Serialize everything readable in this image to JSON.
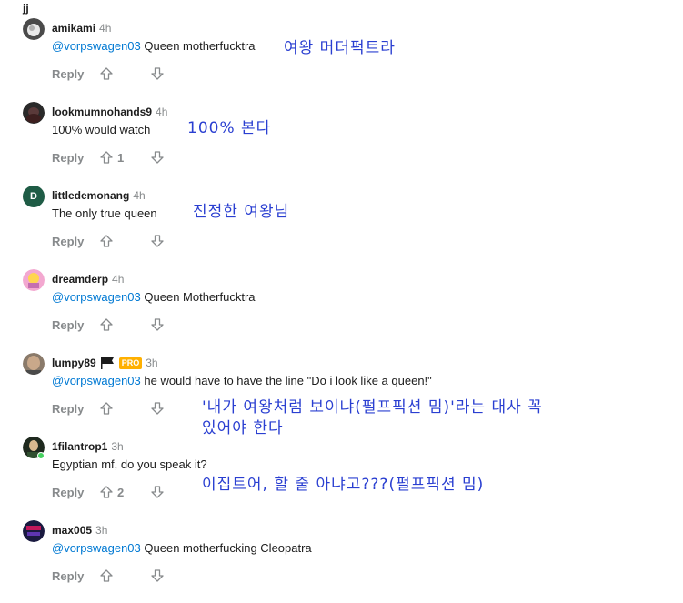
{
  "top_user": "jj",
  "comments": [
    {
      "username": "amikami",
      "time": "4h",
      "mention": "@vorpswagen03",
      "text": "Queen motherfucktra",
      "reply": "Reply",
      "votes": "",
      "annotation": [
        "여왕 머더퍽트라"
      ]
    },
    {
      "username": "lookmumnohands9",
      "time": "4h",
      "mention": "",
      "text": "100% would watch",
      "reply": "Reply",
      "votes": "1",
      "annotation": [
        "100% 본다"
      ]
    },
    {
      "username": "littledemonang",
      "time": "4h",
      "mention": "",
      "text": "The only true queen",
      "reply": "Reply",
      "votes": "",
      "annotation": [
        "진정한 여왕님"
      ],
      "avatar_letter": "D"
    },
    {
      "username": "dreamderp",
      "time": "4h",
      "mention": "@vorpswagen03",
      "text": "Queen Motherfucktra",
      "reply": "Reply",
      "votes": "",
      "annotation": []
    },
    {
      "username": "lumpy89",
      "time": "3h",
      "badge": "PRO",
      "mention": "@vorpswagen03",
      "text": "he would have to have the line \"Do i look like a queen!\"",
      "reply": "Reply",
      "votes": "",
      "annotation": [
        "'내가 여왕처럼 보이냐(펄프픽션 밈)'라는 대사 꼭",
        "있어야 한다"
      ]
    },
    {
      "username": "1filantrop1",
      "time": "3h",
      "mention": "",
      "text": "Egyptian mf, do you speak it?",
      "reply": "Reply",
      "votes": "2",
      "annotation": [
        "이집트어, 할 줄 아냐고???(펄프픽션 밈)"
      ]
    },
    {
      "username": "max005",
      "time": "3h",
      "mention": "@vorpswagen03",
      "text": "Queen motherfucking Cleopatra",
      "reply": "Reply",
      "votes": "",
      "annotation": []
    }
  ],
  "colors": {
    "link": "#0079d3",
    "meta_gray": "#878a8c",
    "annotation_blue": "#2a3fd1",
    "pro_badge": "#ffb000",
    "online": "#46d160"
  },
  "icons": {
    "upvote": "arrow-up-icon",
    "downvote": "arrow-down-icon",
    "flag": "flag-icon"
  }
}
